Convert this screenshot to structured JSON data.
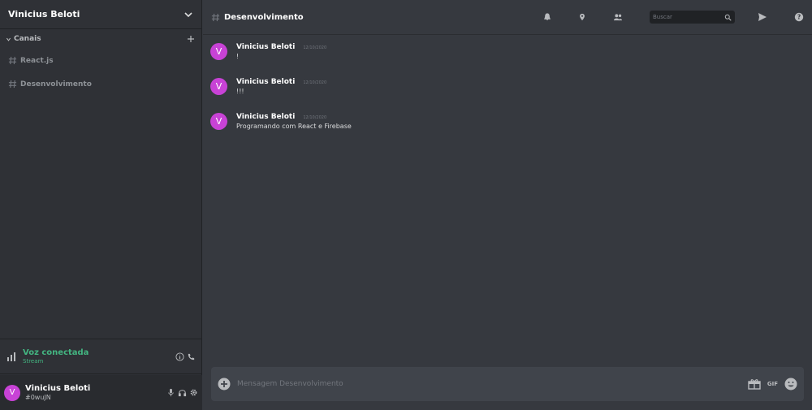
{
  "server": {
    "name": "Vinicius Beloti"
  },
  "sidebar": {
    "category_label": "Canais",
    "channels": [
      {
        "label": "React.js"
      },
      {
        "label": "Desenvolvimento"
      }
    ]
  },
  "voice": {
    "title": "Voz conectada",
    "subtitle": "Stream"
  },
  "user": {
    "name": "Vinicius Beloti",
    "tag": "#0wuJN",
    "initial": "V"
  },
  "channel": {
    "title": "Desenvolvimento"
  },
  "search": {
    "placeholder": "Buscar"
  },
  "messages": [
    {
      "initial": "V",
      "author": "Vinicius Beloti",
      "time": "12/10/2020",
      "text": "!"
    },
    {
      "initial": "V",
      "author": "Vinicius Beloti",
      "time": "12/10/2020",
      "text": "!!!"
    },
    {
      "initial": "V",
      "author": "Vinicius Beloti",
      "time": "12/10/2020",
      "text": "Programando com React e Firebase"
    }
  ],
  "composer": {
    "placeholder": "Mensagem Desenvolvimento",
    "gif_label": "GIF"
  },
  "colors": {
    "accent": "#c842d6",
    "voice": "#43b581",
    "background": "#36393f",
    "sidebar": "#2f3136"
  }
}
